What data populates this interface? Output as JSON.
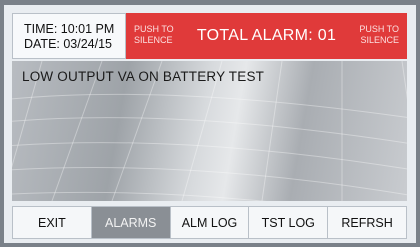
{
  "header": {
    "time": "TIME: 10:01 PM",
    "date": "DATE: 03/24/15",
    "push_left_line1": "PUSH TO",
    "push_left_line2": "SILENCE",
    "total_alarm": "TOTAL ALARM: 01",
    "push_right_line1": "PUSH TO",
    "push_right_line2": "SILENCE",
    "alarm_color": "#e03a3a"
  },
  "display": {
    "message": "LOW OUTPUT VA ON BATTERY TEST"
  },
  "softkeys": [
    {
      "label": "EXIT",
      "active": false
    },
    {
      "label": "ALARMS",
      "active": true
    },
    {
      "label": "ALM LOG",
      "active": false
    },
    {
      "label": "TST LOG",
      "active": false
    },
    {
      "label": "REFRSH",
      "active": false
    }
  ]
}
